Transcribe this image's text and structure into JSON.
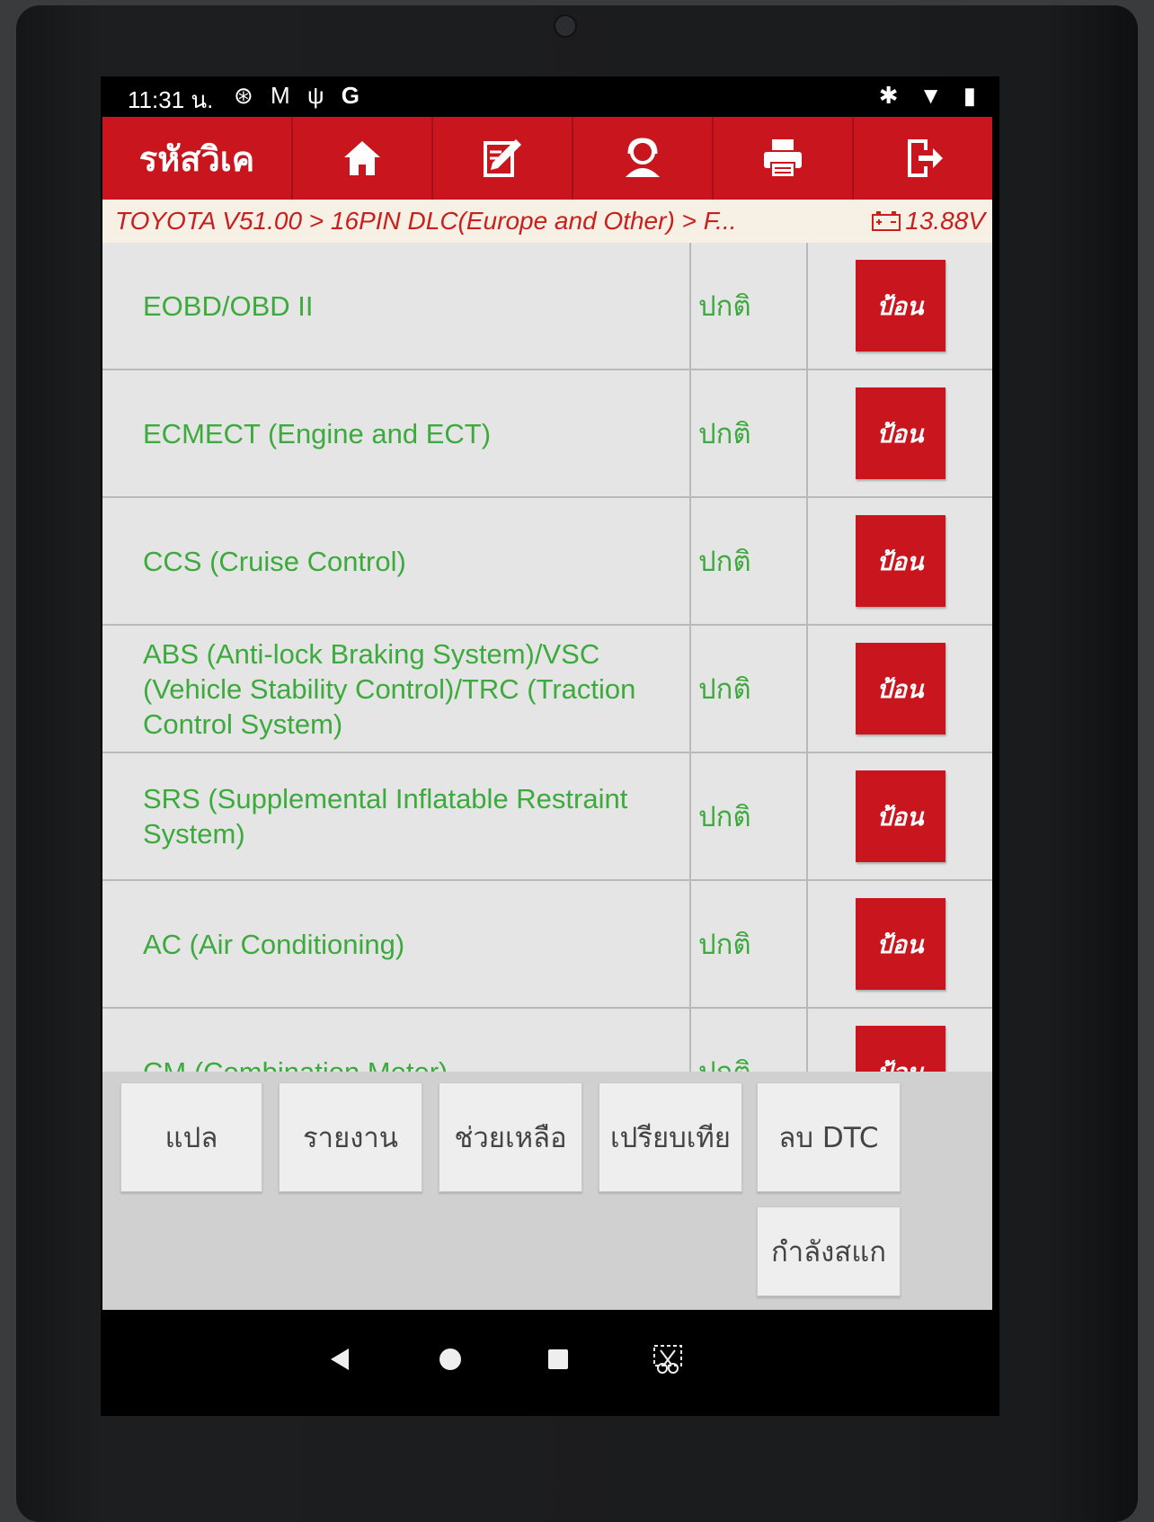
{
  "status_bar": {
    "time": "11:31 น.",
    "left_icons": [
      "aperture-icon",
      "gmail-icon",
      "usb-debug-icon",
      "google-icon"
    ],
    "right_icons": [
      "bluetooth-icon",
      "wifi-icon",
      "battery-icon"
    ]
  },
  "app_bar": {
    "title": "รหัสวิเค",
    "nav_icons": [
      "home-icon",
      "edit-icon",
      "user-icon",
      "print-icon",
      "exit-icon"
    ]
  },
  "breadcrumb": {
    "path": "TOYOTA V51.00 > 16PIN DLC(Europe and Other) > F...",
    "voltage": "13.88V"
  },
  "systems": [
    {
      "name": "EOBD/OBD II",
      "status": "ปกติ",
      "action": "ป้อน"
    },
    {
      "name": "ECMECT (Engine and ECT)",
      "status": "ปกติ",
      "action": "ป้อน"
    },
    {
      "name": "CCS (Cruise Control)",
      "status": "ปกติ",
      "action": "ป้อน"
    },
    {
      "name": "ABS (Anti-lock Braking System)/VSC (Vehicle Stability Control)/TRC (Traction Control System)",
      "status": "ปกติ",
      "action": "ป้อน"
    },
    {
      "name": "SRS (Supplemental Inflatable Restraint System)",
      "status": "ปกติ",
      "action": "ป้อน"
    },
    {
      "name": "AC (Air Conditioning)",
      "status": "ปกติ",
      "action": "ป้อน"
    },
    {
      "name": "CM (Combination Meter)",
      "status": "ปกติ",
      "action": "ป้อน"
    }
  ],
  "function_buttons": {
    "translate": "แปล",
    "report": "รายงาน",
    "help": "ช่วยเหลือ",
    "compare": "เปรียบเทีย",
    "clear_dtc": "ลบ DTC",
    "scanning": "กำลังสแก"
  },
  "colors": {
    "brand_red": "#c9151e",
    "system_text_green": "#3caa3c",
    "breadcrumb_bg": "#f7f0e4"
  }
}
